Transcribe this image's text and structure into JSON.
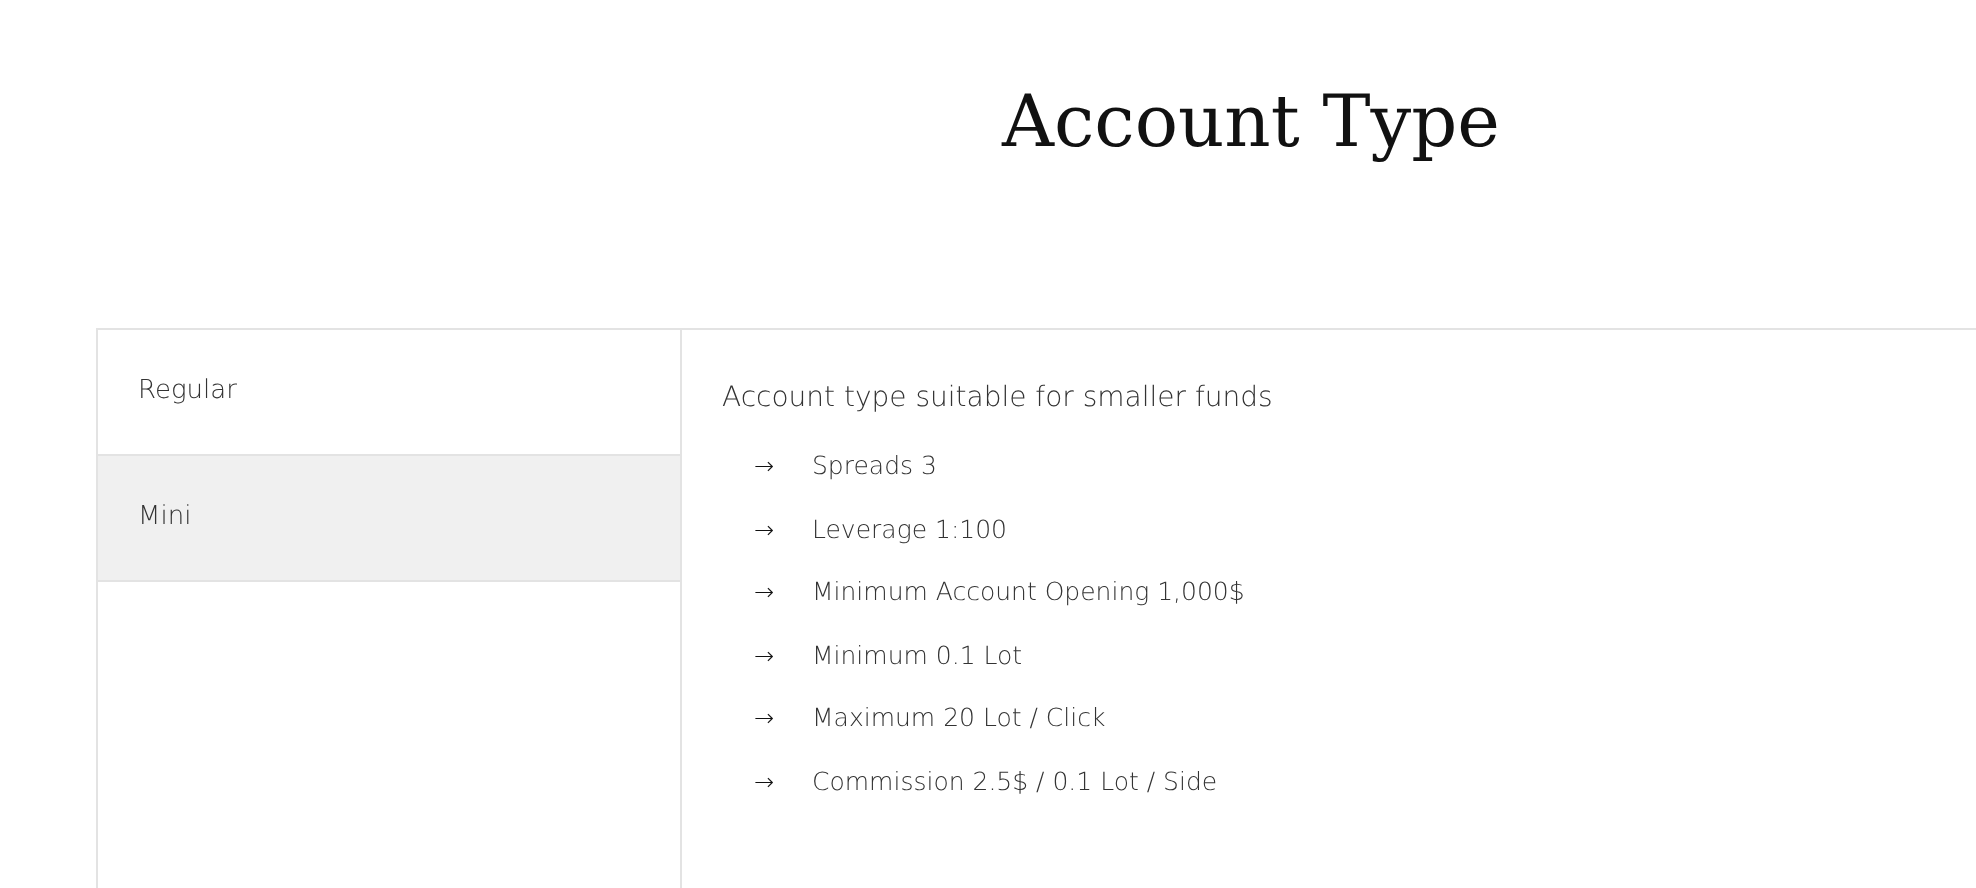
{
  "title": "Account Type",
  "tabs": [
    {
      "label": "Regular",
      "selected": false
    },
    {
      "label": "Mini",
      "selected": true
    }
  ],
  "panel": {
    "description": "Account type suitable for smaller funds",
    "bullet": "→",
    "features": [
      "Spreads 3",
      "Leverage 1:100",
      "Minimum Account Opening 1,000$",
      "Minimum 0.1 Lot",
      "Maximum 20 Lot / Click",
      "Commission 2.5$ / 0.1 Lot / Side"
    ]
  }
}
